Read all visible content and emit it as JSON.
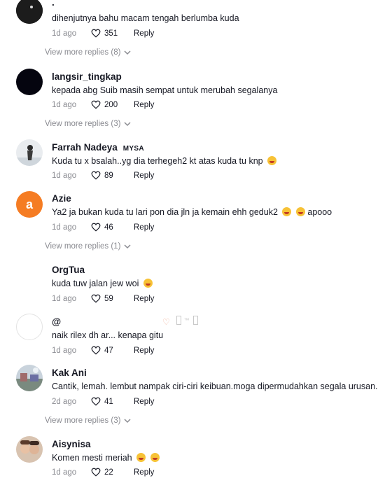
{
  "comments": [
    {
      "name": ".",
      "text": "dihenjutnya bahu macam tengah berlumba kuda",
      "age": "1d ago",
      "likes": "351",
      "reply": "Reply",
      "more": "View more replies (8)"
    },
    {
      "name": "langsir_tingkap",
      "text": "kepada abg Suib masih sempat untuk merubah segalanya",
      "age": "1d ago",
      "likes": "200",
      "reply": "Reply",
      "more": "View more replies (3)"
    },
    {
      "name": "Farrah Nadeya",
      "tag": "MYSA",
      "text": "Kuda tu x bsalah..yg dia terhegeh2 kt atas kuda tu knp",
      "age": "1d ago",
      "likes": "89",
      "reply": "Reply"
    },
    {
      "name": "Azie",
      "avatar_letter": "a",
      "text": "Ya2 ja bukan kuda tu lari pon dia jln ja kemain ehh geduk2",
      "text_suffix": "apooo",
      "age": "1d ago",
      "likes": "46",
      "reply": "Reply",
      "more": "View more replies (1)"
    },
    {
      "name": "OrgTua",
      "text": "kuda tuw jalan jew woi",
      "age": "1d ago",
      "likes": "59",
      "reply": "Reply"
    },
    {
      "name": "@",
      "deco": "™",
      "text": "naik rilex dh ar... kenapa gitu",
      "age": "1d ago",
      "likes": "47",
      "reply": "Reply"
    },
    {
      "name": "Kak Ani",
      "text": "Cantik, lemah. lembut nampak ciri-ciri keibuan.moga dipermudahkan segala urusan.",
      "age": "2d ago",
      "likes": "41",
      "reply": "Reply",
      "more": "View more replies (3)"
    },
    {
      "name": "Aisynisa",
      "text": "Komen mesti meriah",
      "age": "1d ago",
      "likes": "22",
      "reply": "Reply"
    }
  ],
  "colors": {
    "muted": "#8a8b91",
    "text": "#161823",
    "avatar_orange": "#f57c23"
  },
  "icons": {
    "like": "heart-outline-icon",
    "more": "chevron-down-icon",
    "emoji": "laughing-emoji-icon"
  }
}
